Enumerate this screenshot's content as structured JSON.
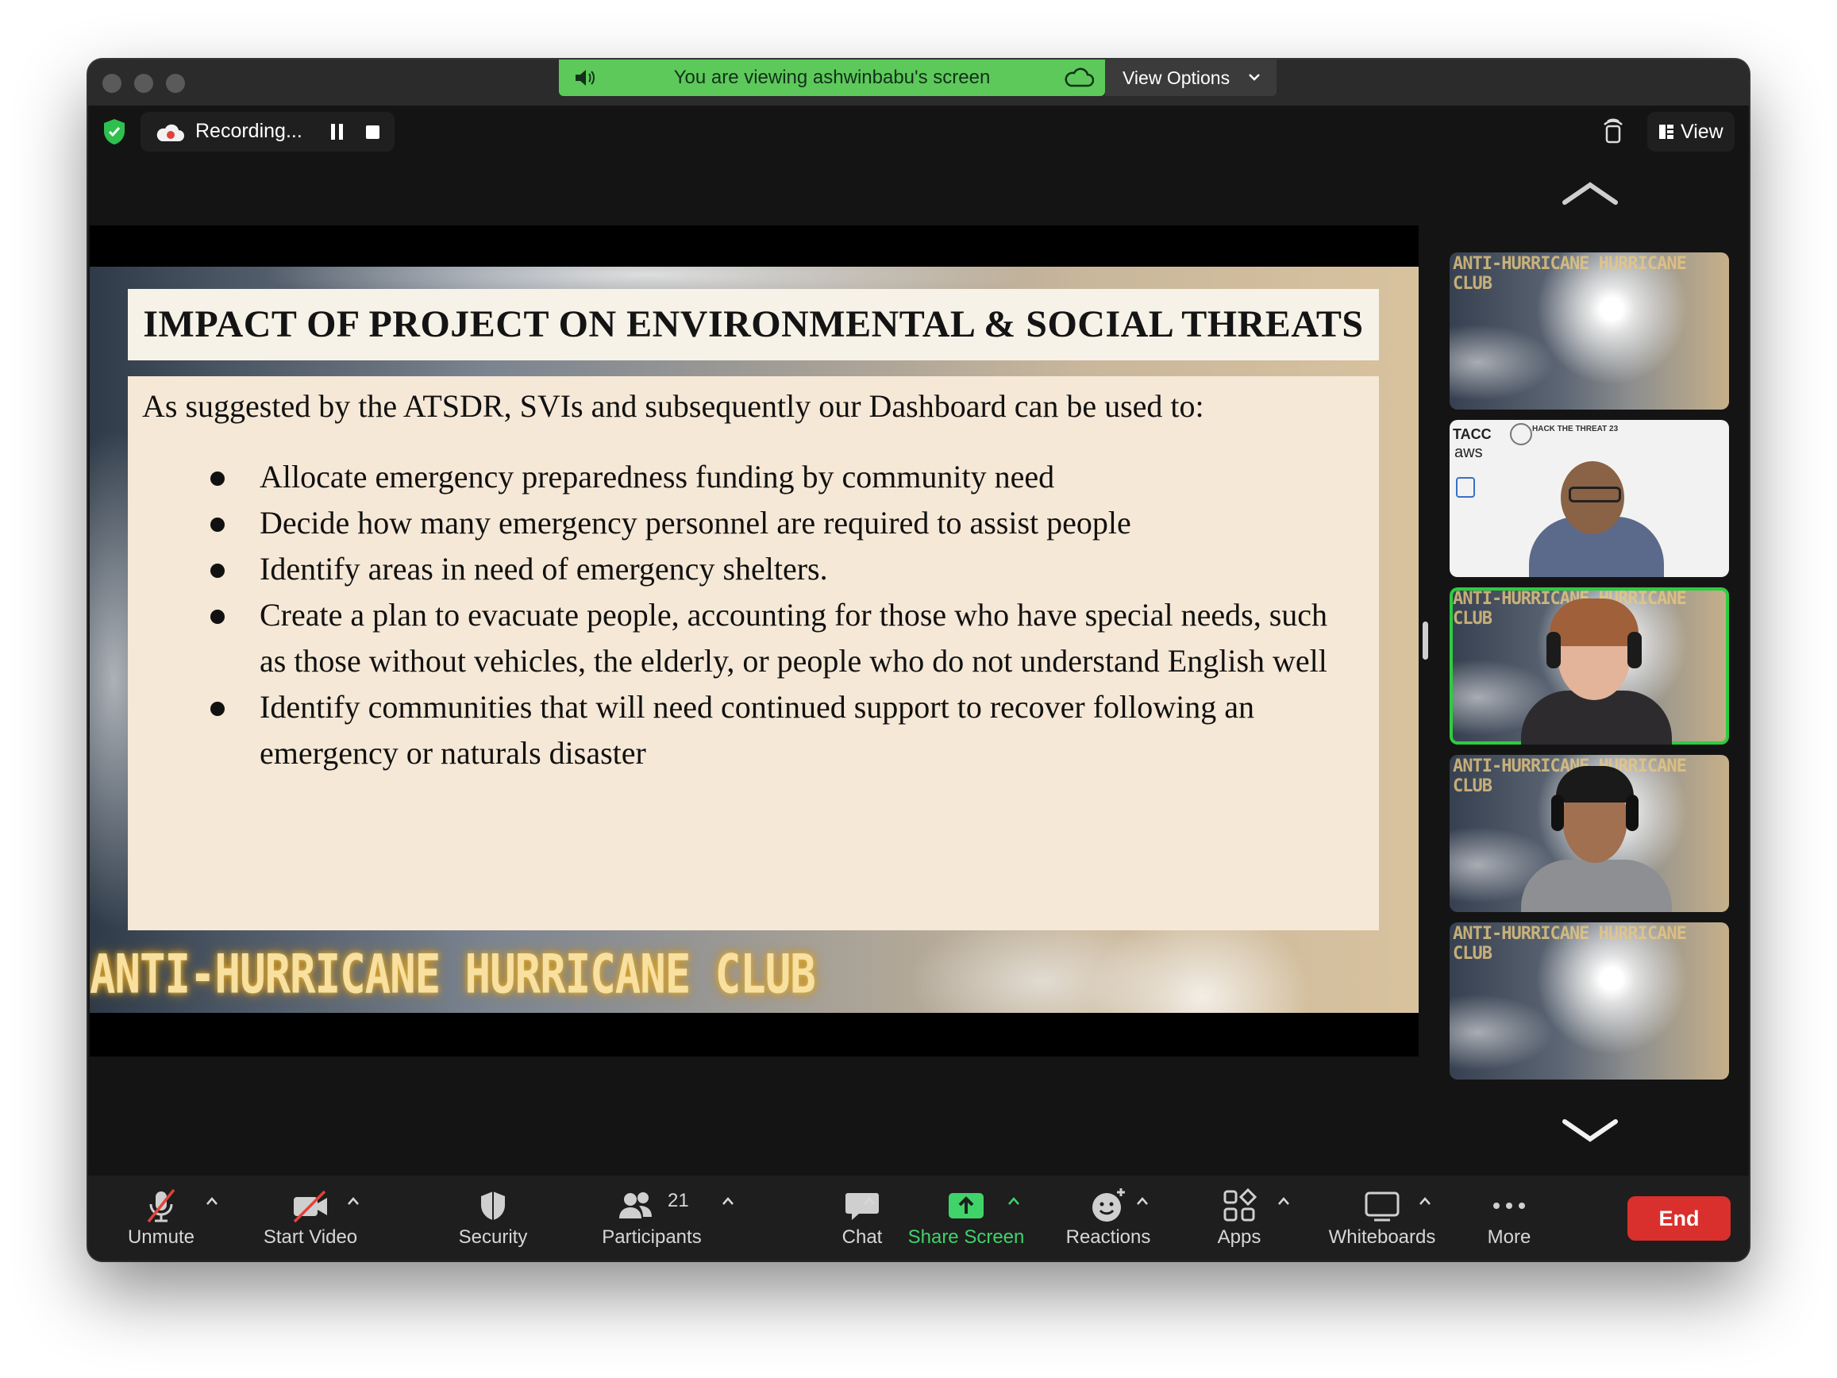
{
  "titlebar": {
    "banner_text": "You are viewing ashwinbabu's screen",
    "view_options_label": "View Options",
    "banner_color": "#5dc95a"
  },
  "recording": {
    "label": "Recording...",
    "view_label": "View"
  },
  "slide": {
    "title": "IMPACT OF PROJECT ON ENVIRONMENTAL & SOCIAL THREATS",
    "intro": "As suggested by the ATSDR, SVIs and subsequently our Dashboard can be used to:",
    "bullets": [
      "Allocate emergency preparedness funding by community need",
      "Decide how many emergency personnel are required to assist people",
      "Identify areas in need of emergency shelters.",
      "Create a plan to evacuate people, accounting for those who have special needs, such as those without vehicles, the elderly, or people who do not understand English well",
      "Identify communities that will need continued support to recover following an emergency or naturals disaster"
    ],
    "footer_logo": "ANTI-HURRICANE HURRICANE CLUB"
  },
  "participants_strip": {
    "tile_tag": "ANTI-HURRICANE HURRICANE CLUB",
    "second_tile_labels": {
      "tacc": "TACC",
      "aws": "aws",
      "hack": "HACK THE THREAT 23"
    },
    "active_speaker_color": "#2ecc40"
  },
  "toolbar": {
    "unmute": "Unmute",
    "start_video": "Start Video",
    "security": "Security",
    "participants": "Participants",
    "participants_count": "21",
    "chat": "Chat",
    "share_screen": "Share Screen",
    "reactions": "Reactions",
    "apps": "Apps",
    "whiteboards": "Whiteboards",
    "more": "More",
    "end": "End",
    "end_color": "#d9302d",
    "share_color": "#3fd36a"
  }
}
